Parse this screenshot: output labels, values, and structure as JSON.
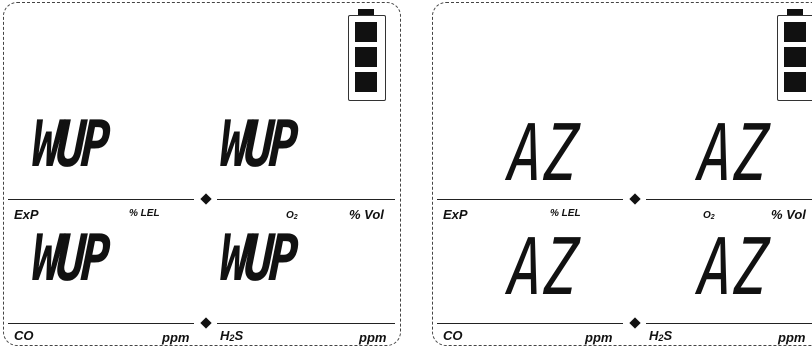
{
  "panels": [
    {
      "readouts": {
        "ex": "WUP",
        "o2": "WUP",
        "co": "WUP",
        "h2s": "WUP"
      },
      "labels": {
        "ex": "ExP",
        "lel": "% LEL",
        "o2": "O2",
        "vol": "% Vol",
        "co": "CO",
        "co_unit": "ppm",
        "h2s": "H2S",
        "h2s_unit": "ppm"
      },
      "battery_level_bars": 3
    },
    {
      "readouts": {
        "ex": "AZ",
        "o2": "AZ",
        "co": "AZ",
        "h2s": "AZ"
      },
      "labels": {
        "ex": "ExP",
        "lel": "% LEL",
        "o2": "O2",
        "vol": "% Vol",
        "co": "CO",
        "co_unit": "ppm",
        "h2s": "H2S",
        "h2s_unit": "ppm"
      },
      "battery_level_bars": 3
    }
  ],
  "icons": {
    "battery": "battery-full-icon",
    "separator": "diamond-separator-icon"
  }
}
